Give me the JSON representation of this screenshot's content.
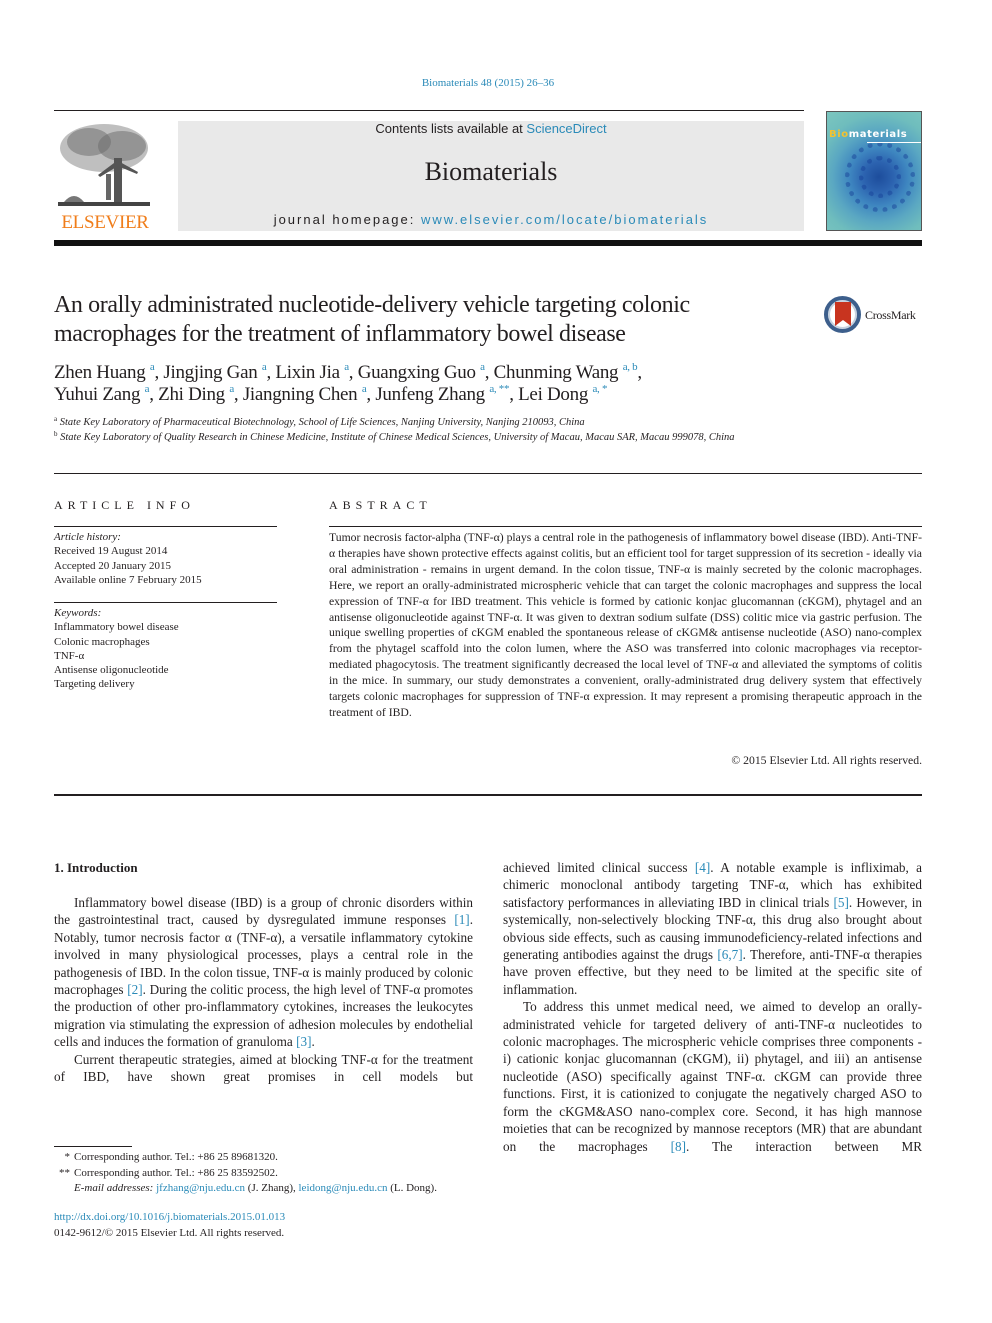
{
  "header": {
    "citation": "Biomaterials 48 (2015) 26–36",
    "contents_prefix": "Contents lists available at ",
    "contents_link": "ScienceDirect",
    "journal_name": "Biomaterials",
    "homepage_prefix": "journal homepage: ",
    "homepage_link": "www.elsevier.com/locate/biomaterials",
    "publisher_wordmark": "ELSEVIER",
    "cover_title_highlight": "Bio",
    "cover_title_rest": "materials",
    "crossmark_label": "CrossMark"
  },
  "article": {
    "title": "An orally administrated nucleotide-delivery vehicle targeting colonic macrophages for the treatment of inflammatory bowel disease",
    "authors": [
      {
        "name": "Zhen Huang",
        "sup": "a",
        "sep": ", "
      },
      {
        "name": "Jingjing Gan",
        "sup": "a",
        "sep": ", "
      },
      {
        "name": "Lixin Jia",
        "sup": "a",
        "sep": ", "
      },
      {
        "name": "Guangxing Guo",
        "sup": "a",
        "sep": ", "
      },
      {
        "name": "Chunming Wang",
        "sup": "a, b",
        "sep": ","
      },
      {
        "name": "Yuhui Zang",
        "sup": "a",
        "sep": ", "
      },
      {
        "name": "Zhi Ding",
        "sup": "a",
        "sep": ", "
      },
      {
        "name": "Jiangning Chen",
        "sup": "a",
        "sep": ", "
      },
      {
        "name": "Junfeng Zhang",
        "sup": "a, **",
        "sep": ", "
      },
      {
        "name": "Lei Dong",
        "sup": "a, *",
        "sep": ""
      }
    ],
    "affiliations": [
      {
        "mark": "a",
        "text": "State Key Laboratory of Pharmaceutical Biotechnology, School of Life Sciences, Nanjing University, Nanjing 210093, China"
      },
      {
        "mark": "b",
        "text": "State Key Laboratory of Quality Research in Chinese Medicine, Institute of Chinese Medical Sciences, University of Macau, Macau SAR, Macau 999078, China"
      }
    ]
  },
  "article_info": {
    "heading": "ARTICLE INFO",
    "history_label": "Article history:",
    "history": [
      "Received 19 August 2014",
      "Accepted 20 January 2015",
      "Available online 7 February 2015"
    ],
    "keywords_label": "Keywords:",
    "keywords": [
      "Inflammatory bowel disease",
      "Colonic macrophages",
      "TNF-α",
      "Antisense oligonucleotide",
      "Targeting delivery"
    ]
  },
  "abstract": {
    "heading": "ABSTRACT",
    "text": "Tumor necrosis factor-alpha (TNF-α) plays a central role in the pathogenesis of inflammatory bowel disease (IBD). Anti-TNF-α therapies have shown protective effects against colitis, but an efficient tool for target suppression of its secretion - ideally via oral administration - remains in urgent demand. In the colon tissue, TNF-α is mainly secreted by the colonic macrophages. Here, we report an orally-administrated microspheric vehicle that can target the colonic macrophages and suppress the local expression of TNF-α for IBD treatment. This vehicle is formed by cationic konjac glucomannan (cKGM), phytagel and an antisense oligonucleotide against TNF-α. It was given to dextran sodium sulfate (DSS) colitic mice via gastric perfusion. The unique swelling properties of cKGM enabled the spontaneous release of cKGM& antisense nucleotide (ASO) nano-complex from the phytagel scaffold into the colon lumen, where the ASO was transferred into colonic macrophages via receptor-mediated phagocytosis. The treatment significantly decreased the local level of TNF-α and alleviated the symptoms of colitis in the mice. In summary, our study demonstrates a convenient, orally-administrated drug delivery system that effectively targets colonic macrophages for suppression of TNF-α expression. It may represent a promising therapeutic approach in the treatment of IBD.",
    "copyright": "© 2015 Elsevier Ltd. All rights reserved."
  },
  "body": {
    "intro_heading": "1.  Introduction",
    "left_col": {
      "p1_a": "Inflammatory bowel disease (IBD) is a group of chronic disorders within the gastrointestinal tract, caused by dysregulated immune responses ",
      "ref1": "[1]",
      "p1_b": ". Notably, tumor necrosis factor α (TNF-α), a versatile inflammatory cytokine involved in many physiological processes, plays a central role in the pathogenesis of IBD. In the colon tissue, TNF-α is mainly produced by colonic macrophages ",
      "ref2": "[2]",
      "p1_c": ". During the colitic process, the high level of TNF-α promotes the production of other pro-inflammatory cytokines, increases the leukocytes migration via stimulating the expression of adhesion molecules by endothelial cells and induces the formation of granuloma ",
      "ref3": "[3]",
      "p1_d": ".",
      "p2": "Current therapeutic strategies, aimed at blocking TNF-α for the treatment of IBD, have shown great promises in cell models but"
    },
    "right_col": {
      "p1_a": "achieved limited clinical success ",
      "ref4": "[4]",
      "p1_b": ". A notable example is infliximab, a chimeric monoclonal antibody targeting TNF-α, which has exhibited satisfactory performances in alleviating IBD in clinical trials ",
      "ref5": "[5]",
      "p1_c": ". However, in systemically, non-selectively blocking TNF-α, this drug also brought about obvious side effects, such as causing immunodeficiency-related infections and generating antibodies against the drugs ",
      "ref67": "[6,7]",
      "p1_d": ". Therefore, anti-TNF-α therapies have proven effective, but they need to be limited at the specific site of inflammation.",
      "p2_a": "To address this unmet medical need, we aimed to develop an orally-administrated vehicle for targeted delivery of anti-TNF-α nucleotides to colonic macrophages. The microspheric vehicle comprises three components - i) cationic konjac glucomannan (cKGM), ii) phytagel, and iii) an antisense nucleotide (ASO) specifically against TNF-α. cKGM can provide three functions. First, it is cationized to conjugate the negatively charged ASO to form the cKGM&ASO nano-complex core. Second, it has high mannose moieties that can be recognized by mannose receptors (MR) that are abundant on the macrophages ",
      "ref8": "[8]",
      "p2_b": ". The interaction between MR"
    }
  },
  "footnotes": {
    "fn1_mark": "*",
    "fn1_text": "Corresponding author. Tel.: +86 25 89681320.",
    "fn2_mark": "**",
    "fn2_text": "Corresponding author. Tel.: +86 25 83592502.",
    "email_label": "E-mail addresses: ",
    "email1": "jfzhang@nju.edu.cn",
    "email1_name": " (J. Zhang), ",
    "email2": "leidong@nju.edu.cn",
    "email2_name": " (L. Dong).",
    "doi": "http://dx.doi.org/10.1016/j.biomaterials.2015.01.013",
    "issn_line": "0142-9612/© 2015 Elsevier Ltd. All rights reserved."
  }
}
